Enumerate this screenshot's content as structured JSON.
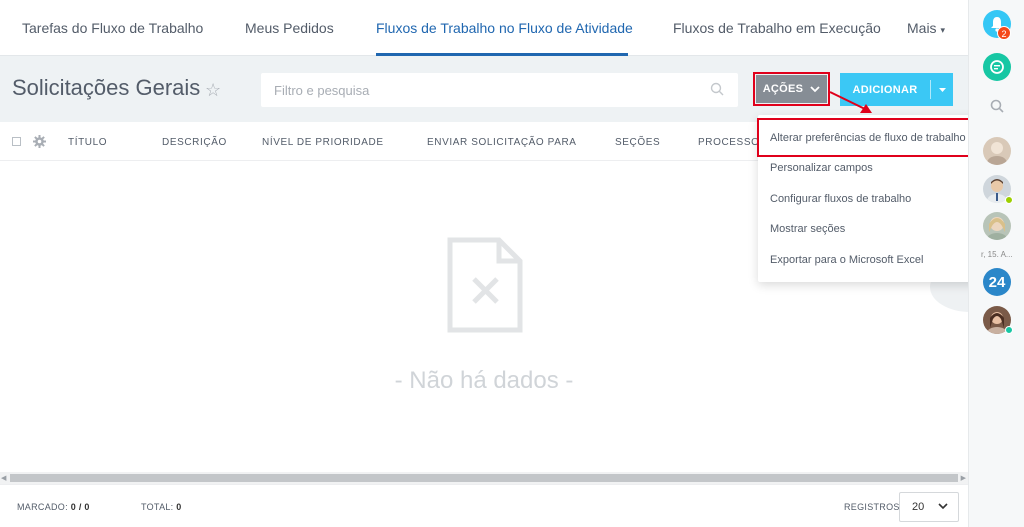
{
  "nav": {
    "tabs": [
      {
        "label": "Tarefas do Fluxo de Trabalho"
      },
      {
        "label": "Meus Pedidos"
      },
      {
        "label": "Fluxos de Trabalho no Fluxo de Atividade"
      },
      {
        "label": "Fluxos de Trabalho em Execução"
      },
      {
        "label": "Mais"
      }
    ],
    "active_tab": "Fluxos de Trabalho no Fluxo de Atividade"
  },
  "page": {
    "title": "Solicitações Gerais",
    "star_glyph": "☆"
  },
  "search": {
    "placeholder": "Filtro e pesquisa"
  },
  "toolbar": {
    "actions_label": "AÇÕES",
    "add_label": "ADICIONAR"
  },
  "grid": {
    "columns": [
      "TÍTULO",
      "DESCRIÇÃO",
      "NÍVEL DE PRIORIDADE",
      "ENVIAR SOLICITAÇÃO PARA",
      "SEÇÕES",
      "PROCESSOS"
    ],
    "empty_text": "- Não há dados -"
  },
  "actions_menu": {
    "items": [
      "Alterar preferências de fluxo de trabalho",
      "Personalizar campos",
      "Configurar fluxos de trabalho",
      "Mostrar seções",
      "Exportar para o Microsoft Excel"
    ],
    "highlighted_index": 0
  },
  "footer": {
    "marked_label": "MARCADO:",
    "marked_value": "0 / 0",
    "total_label": "TOTAL:",
    "total_value": "0",
    "records_label": "REGISTROS:",
    "records_value": "20"
  },
  "sidebar": {
    "notification_count": "2",
    "truncated_text": "r, 15. A...",
    "b24_label": "24"
  },
  "colors": {
    "accent_blue": "#2067b0",
    "add_button": "#3bc8f5",
    "actions_button": "#868d95",
    "highlight_red": "#e0001b"
  }
}
